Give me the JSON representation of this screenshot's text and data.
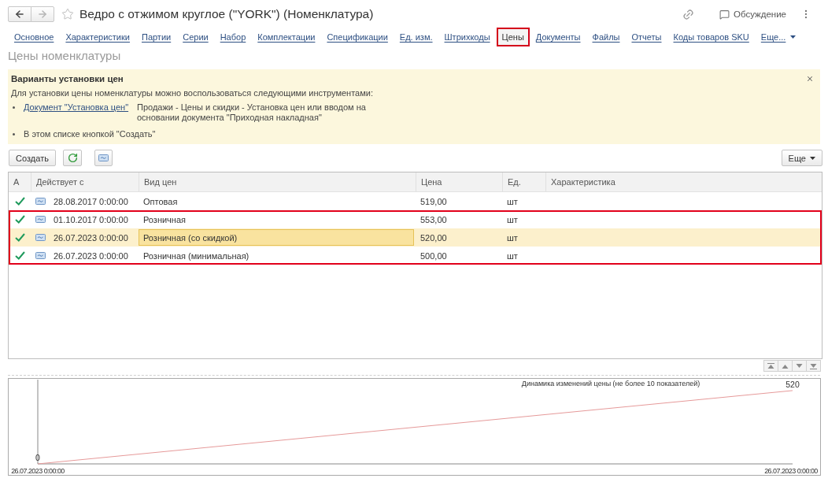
{
  "window": {
    "title": "Ведро с отжимом круглое (\"YORK\") (Номенклатура)"
  },
  "header": {
    "nav": [
      {
        "kind": "back",
        "disabled": false
      },
      {
        "kind": "forward",
        "disabled": true
      }
    ],
    "favorite": false,
    "discussion": "Обсуждение"
  },
  "tabs": [
    {
      "label": "Основное",
      "selected": false
    },
    {
      "label": "Характеристики",
      "selected": false
    },
    {
      "label": "Партии",
      "selected": false
    },
    {
      "label": "Серии",
      "selected": false
    },
    {
      "label": "Набор",
      "selected": false
    },
    {
      "label": "Комплектации",
      "selected": false
    },
    {
      "label": "Спецификации",
      "selected": false
    },
    {
      "label": "Ед. изм.",
      "selected": false
    },
    {
      "label": "Штрихкоды",
      "selected": false
    },
    {
      "label": "Цены",
      "selected": true
    },
    {
      "label": "Документы",
      "selected": false
    },
    {
      "label": "Файлы",
      "selected": false
    },
    {
      "label": "Отчеты",
      "selected": false
    },
    {
      "label": "Коды товаров SKU",
      "selected": false
    }
  ],
  "tabs_more": "Еще...",
  "section_title": "Цены номенклатуры",
  "info_panel": {
    "title": "Варианты установки цен",
    "intro": "Для установки цены номенклатуры можно воспользоваться следующими инструментами:",
    "items": [
      {
        "kind": "link",
        "link": "Документ \"Установка цен\"",
        "text": "Продажи - Цены и скидки - Установка цен или вводом на основании документа \"Приходная накладная\""
      },
      {
        "kind": "plain",
        "text": "В этом списке кнопкой \"Создать\""
      }
    ]
  },
  "toolbar": {
    "create": "Создать",
    "more": "Еще"
  },
  "table": {
    "columns": [
      "А",
      "Действует с",
      "Вид цен",
      "Цена",
      "Ед.",
      "Характеристика"
    ],
    "rows": [
      {
        "active": true,
        "date": "28.08.2017 0:00:00",
        "price_type": "Оптовая",
        "price": "519,00",
        "unit": "шт",
        "selected": false,
        "highlighted": false
      },
      {
        "active": true,
        "date": "01.10.2017 0:00:00",
        "price_type": "Розничная",
        "price": "553,00",
        "unit": "шт",
        "selected": false,
        "highlighted": true
      },
      {
        "active": true,
        "date": "26.07.2023 0:00:00",
        "price_type": "Розничная (со скидкой)",
        "price": "520,00",
        "unit": "шт",
        "selected": true,
        "highlighted": true
      },
      {
        "active": true,
        "date": "26.07.2023 0:00:00",
        "price_type": "Розничная (минимальная)",
        "price": "500,00",
        "unit": "шт",
        "selected": false,
        "highlighted": true
      }
    ]
  },
  "chart": {
    "chart_data": {
      "type": "line",
      "title": "Динамика изменений цены (не более 10 показателей)",
      "categories": [
        "26.07.2023 0:00:00",
        "26.07.2023 0:00:00"
      ],
      "series": [
        {
          "color": "#e69a9a",
          "values": [
            0,
            520
          ]
        }
      ],
      "data_labels": true
    }
  }
}
